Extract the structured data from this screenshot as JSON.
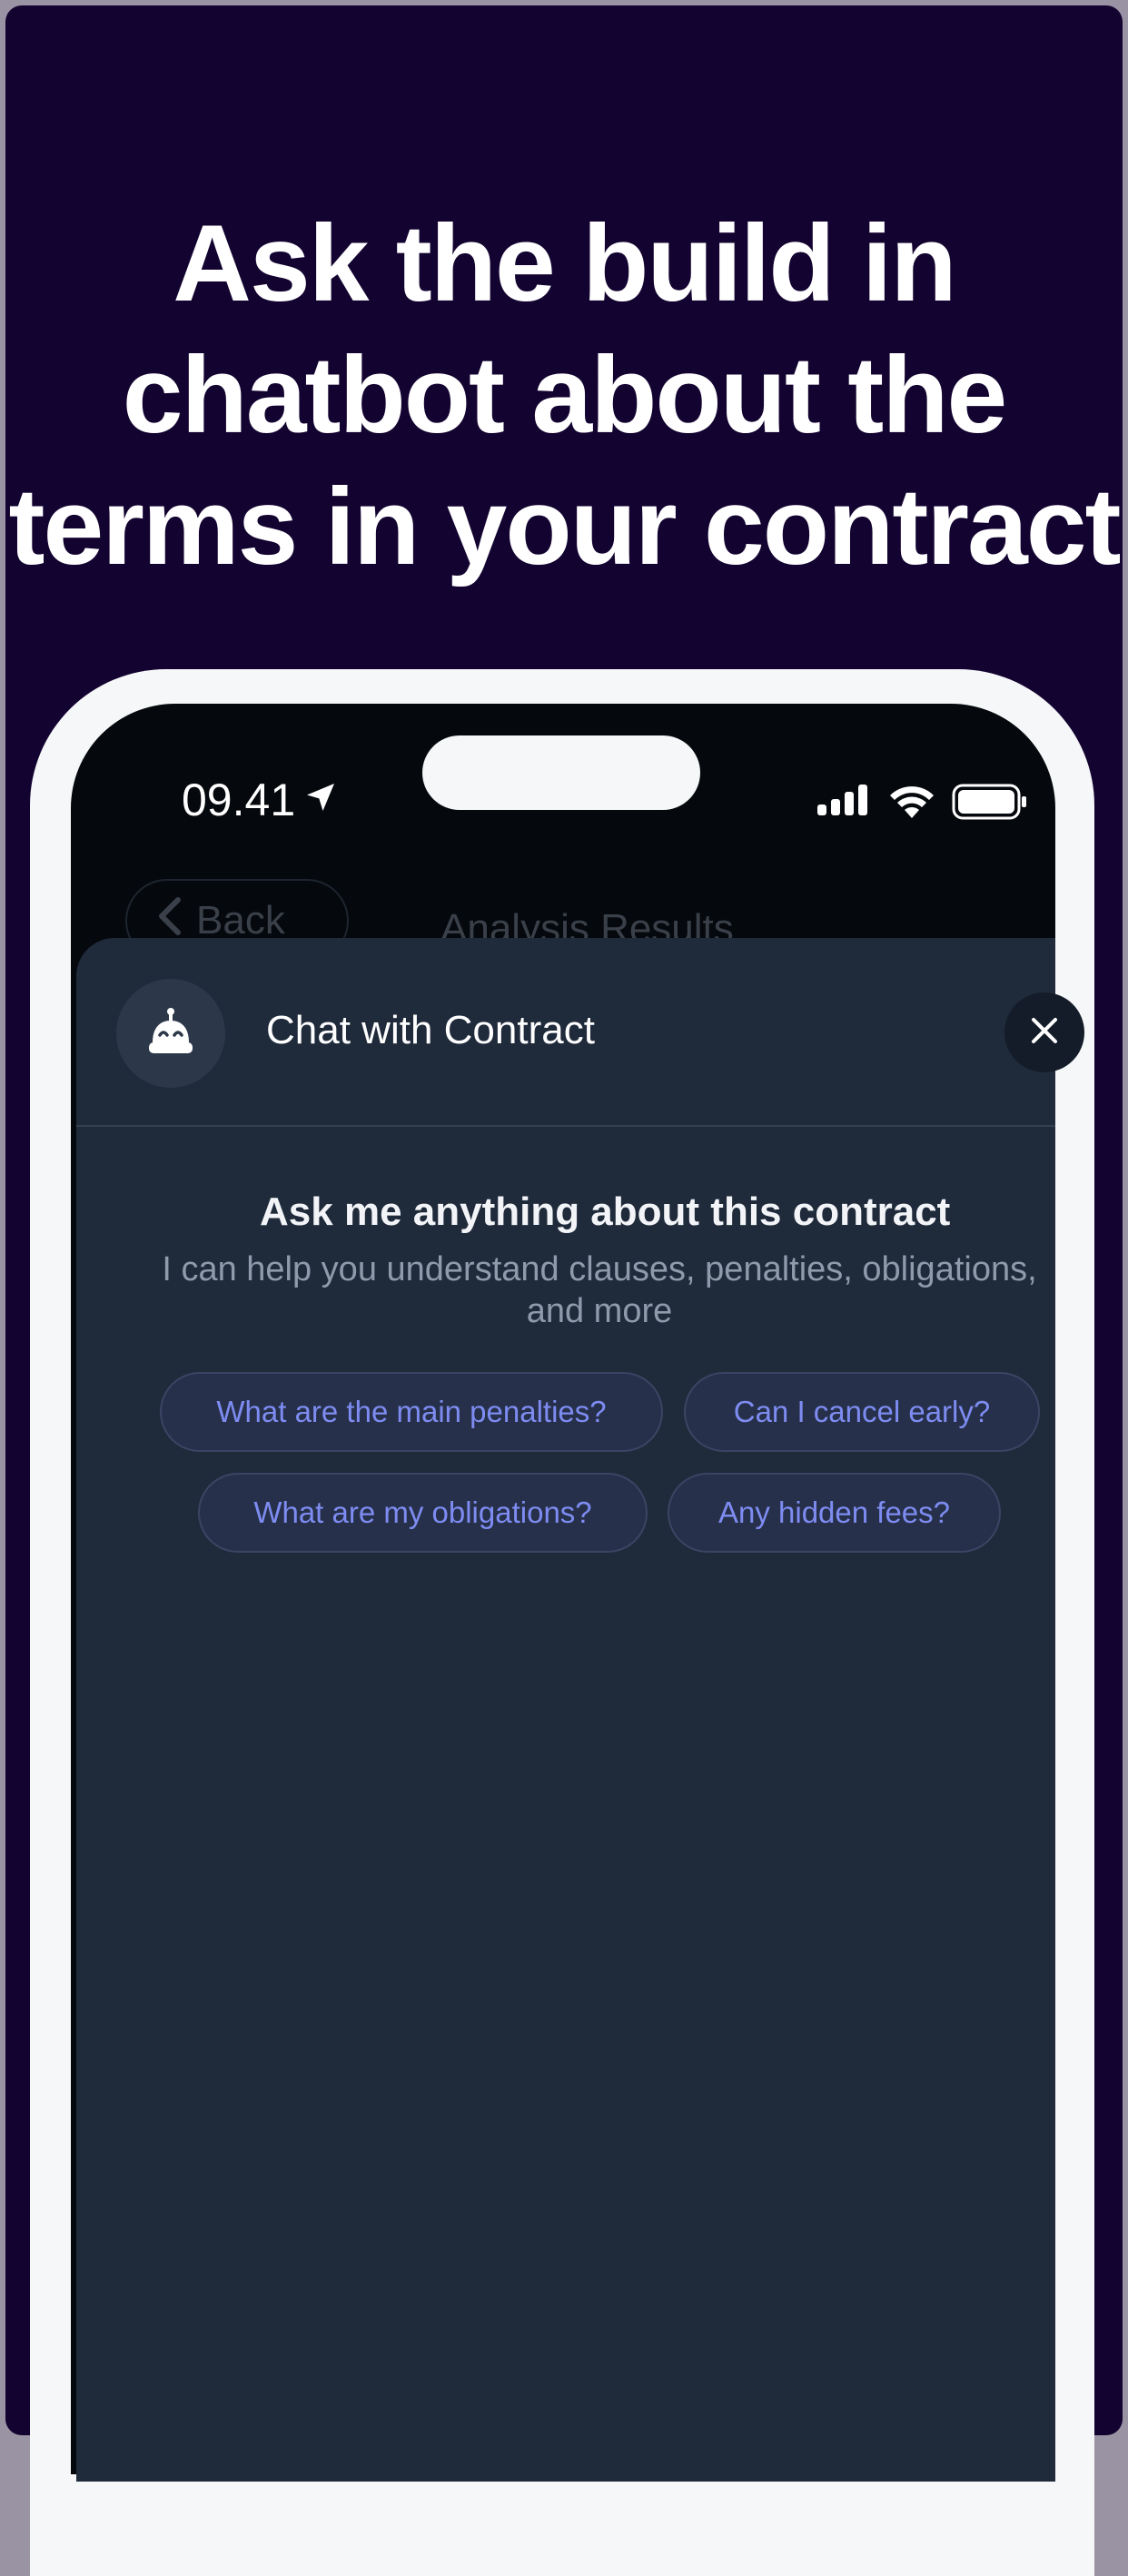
{
  "headline": {
    "line1": "Ask the build in",
    "line2": "chatbot about the",
    "line3": "terms in your contract"
  },
  "status_bar": {
    "time": "09.41",
    "icons": [
      "location-arrow-icon",
      "cellular-signal-icon",
      "wifi-icon",
      "battery-icon"
    ]
  },
  "nav": {
    "back_label": "Back",
    "title": "Analysis Results"
  },
  "chat": {
    "title": "Chat with Contract",
    "intro_title": "Ask me anything about this contract",
    "intro_subtitle_line1": "I can help you understand clauses, penalties, obligations,",
    "intro_subtitle_line2": "and more",
    "suggestions": [
      "What are the main penalties?",
      "Can I cancel early?",
      "What are my obligations?",
      "Any hidden fees?"
    ]
  },
  "colors": {
    "background": "#130330",
    "sheet": "#1f2a3b",
    "accent": "#7e8cf2"
  }
}
